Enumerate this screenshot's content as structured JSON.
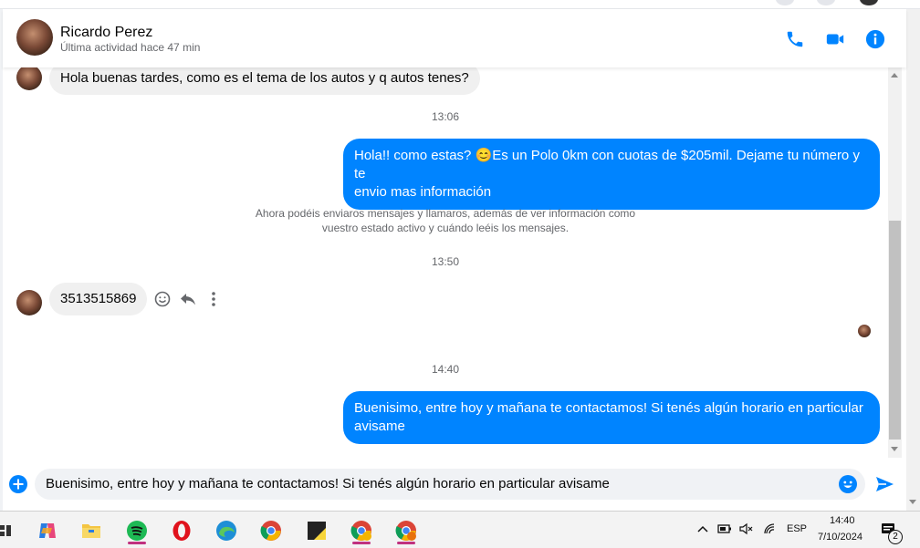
{
  "header": {
    "name": "Ricardo Perez",
    "status": "Última actividad hace 47 min"
  },
  "messages": {
    "m1": "Hola buenas tardes,  como es el tema de los autos y q autos tenes?",
    "t1": "13:06",
    "m2_line1": "Hola!! como estas? 😊Es un Polo 0km con cuotas de $205mil. Dejame tu número y te",
    "m2_line2": "envio mas información",
    "notice_line1": "Ahora podéis enviaros mensajes y llamaros, además de ver información como",
    "notice_line2": "vuestro estado activo y cuándo leéis los mensajes.",
    "t2": "13:50",
    "m3": "3513515869",
    "t3": "14:40",
    "m4_line1": "Buenisimo, entre hoy y mañana te contactamos! Si tenés algún horario en particular",
    "m4_line2": "avisame"
  },
  "composer": {
    "text": "Buenisimo, entre hoy y mañana te contactamos! Si tenés algún horario en particular avisame"
  },
  "icons": {
    "header": [
      "phone-icon",
      "video-icon",
      "info-icon"
    ],
    "message_actions": [
      "emoji-react-icon",
      "reply-icon",
      "more-icon"
    ],
    "composer": [
      "add-icon",
      "emoji-icon",
      "send-icon"
    ]
  },
  "colors": {
    "accent": "#0084ff",
    "incoming_bubble": "#f0f0f0"
  },
  "taskbar": {
    "apps": [
      "copilot",
      "file-explorer",
      "spotify",
      "opera",
      "edge",
      "chrome",
      "sticky-notes",
      "chrome-profile-1",
      "chrome-profile-2"
    ],
    "lang": "ESP",
    "time": "14:40",
    "date": "7/10/2024",
    "notifications": "2"
  }
}
